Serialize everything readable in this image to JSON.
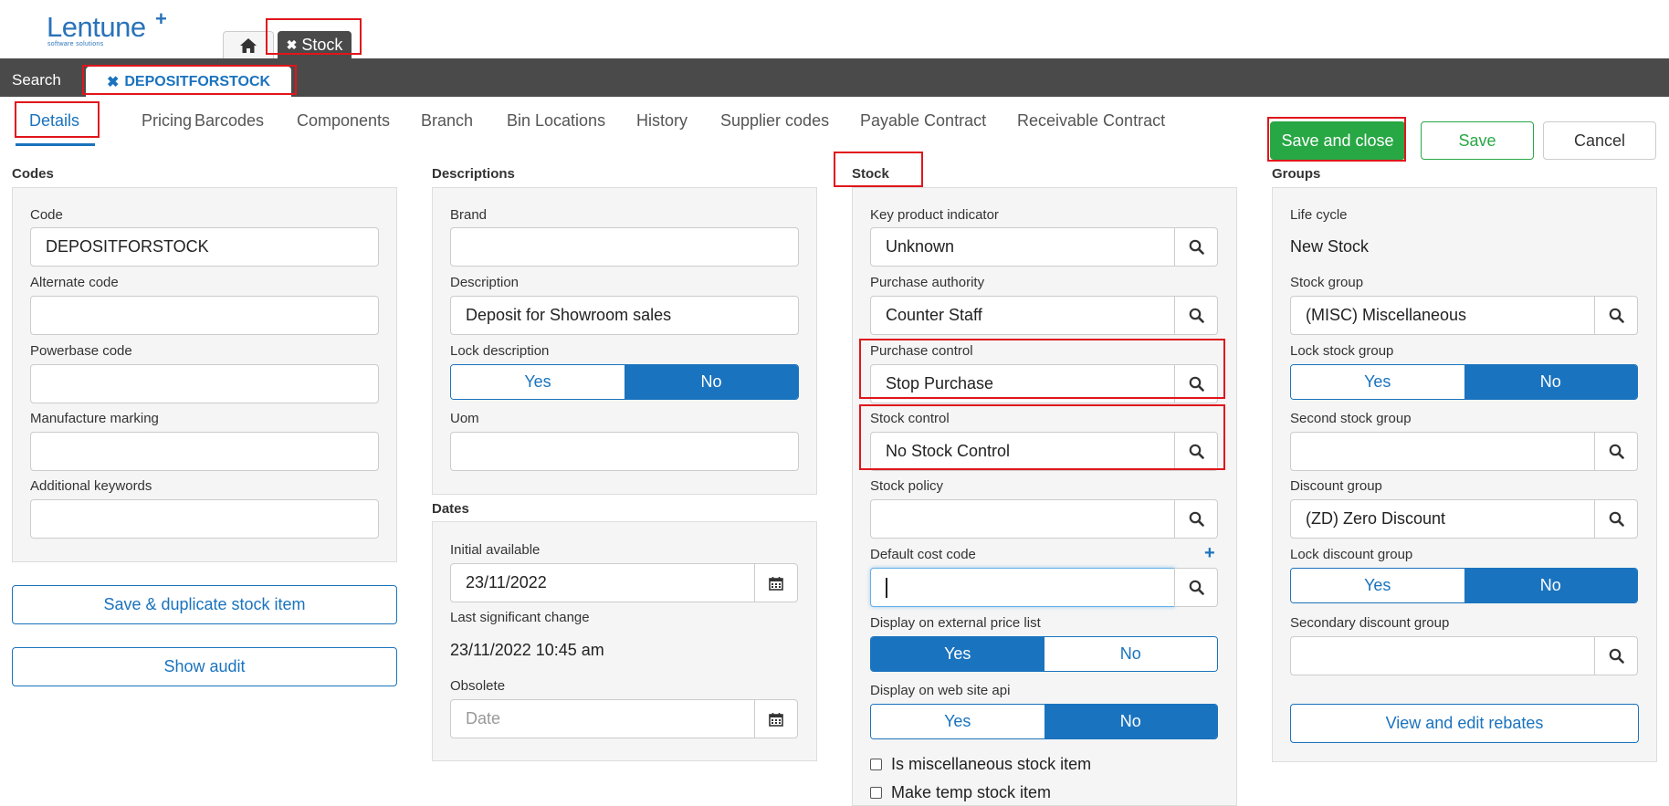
{
  "header": {
    "logo_text": "Lentune",
    "logo_plus": "+",
    "logo_sub": "software solutions",
    "stock_tab": "Stock",
    "search_label": "Search",
    "record_tab": "DEPOSITFORSTOCK"
  },
  "tabs": [
    "Details",
    "Pricing",
    "Barcodes",
    "Components",
    "Branch",
    "Bin Locations",
    "History",
    "Supplier codes",
    "Payable Contract",
    "Receivable Contract"
  ],
  "actions": {
    "save_close": "Save and close",
    "save": "Save",
    "cancel": "Cancel"
  },
  "codes": {
    "title": "Codes",
    "code_label": "Code",
    "code_value": "DEPOSITFORSTOCK",
    "alt_code_label": "Alternate code",
    "powerbase_label": "Powerbase code",
    "manufacture_label": "Manufacture marking",
    "keywords_label": "Additional keywords",
    "duplicate_button": "Save & duplicate stock item",
    "audit_button": "Show audit"
  },
  "descriptions": {
    "title": "Descriptions",
    "brand_label": "Brand",
    "description_label": "Description",
    "description_value": "Deposit for Showroom sales",
    "lock_label": "Lock description",
    "yes": "Yes",
    "no": "No",
    "uom_label": "Uom"
  },
  "dates": {
    "title": "Dates",
    "initial_label": "Initial available",
    "initial_value": "23/11/2022",
    "last_change_label": "Last significant change",
    "last_change_value": "23/11/2022 10:45 am",
    "obsolete_label": "Obsolete",
    "obsolete_placeholder": "Date"
  },
  "stock": {
    "title": "Stock",
    "kpi_label": "Key product indicator",
    "kpi_value": "Unknown",
    "purchase_auth_label": "Purchase authority",
    "purchase_auth_value": "Counter Staff",
    "purchase_control_label": "Purchase control",
    "purchase_control_value": "Stop Purchase",
    "stock_control_label": "Stock control",
    "stock_control_value": "No Stock Control",
    "stock_policy_label": "Stock policy",
    "cost_code_label": "Default cost code",
    "ext_price_label": "Display on external price list",
    "web_api_label": "Display on web site api",
    "yes": "Yes",
    "no": "No",
    "misc_label": "Is miscellaneous stock item",
    "temp_label": "Make temp stock item"
  },
  "groups": {
    "title": "Groups",
    "life_cycle_label": "Life cycle",
    "life_cycle_value": "New Stock",
    "stock_group_label": "Stock group",
    "stock_group_value": "(MISC) Miscellaneous",
    "lock_stock_group_label": "Lock stock group",
    "second_group_label": "Second stock group",
    "discount_group_label": "Discount group",
    "discount_group_value": "(ZD) Zero Discount",
    "lock_discount_label": "Lock discount group",
    "secondary_discount_label": "Secondary discount group",
    "rebates_button": "View and edit rebates",
    "yes": "Yes",
    "no": "No"
  },
  "colors": {
    "accent": "#1a73be",
    "success": "#28a745",
    "dark_bar": "#4a4a4a",
    "highlight": "#e0161b"
  }
}
